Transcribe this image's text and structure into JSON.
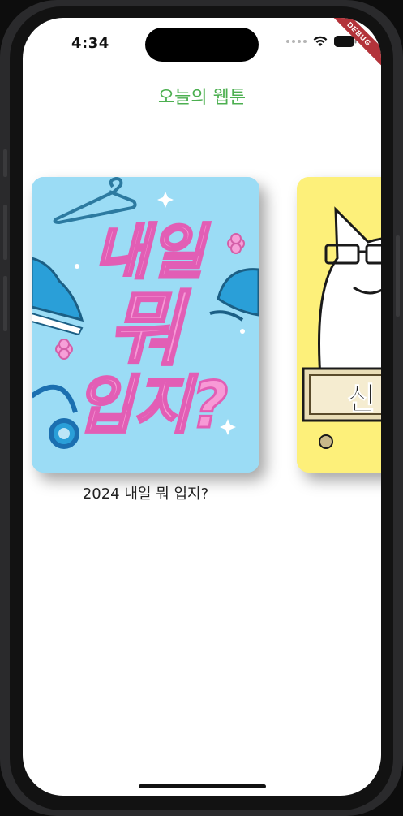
{
  "status_bar": {
    "time": "4:34",
    "debug_label": "DEBUG"
  },
  "app": {
    "title": "오늘의 웹툰"
  },
  "webtoons": [
    {
      "title": "2024 내일 뭐 입지?",
      "cover_text": [
        "내일",
        "뭐",
        "입지?"
      ],
      "cover_color": "#9bdcf5"
    },
    {
      "title": "",
      "cover_text": [
        "신"
      ],
      "cover_color": "#fdf07a"
    }
  ],
  "colors": {
    "title_green": "#4caf50",
    "debug_red": "#b3333a"
  }
}
